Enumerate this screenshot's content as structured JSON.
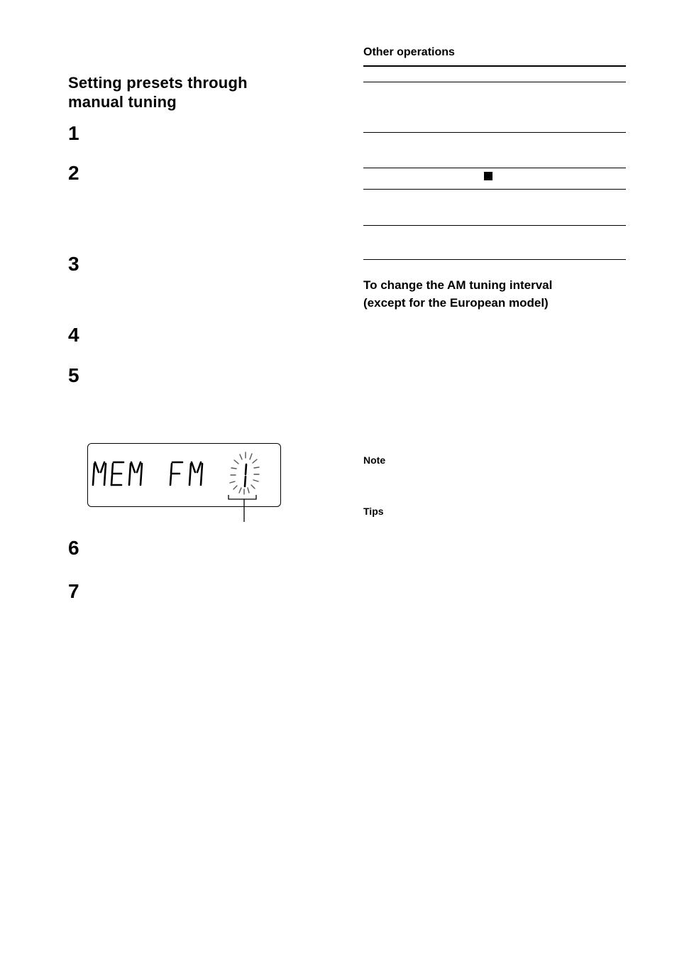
{
  "left_column": {
    "heading": "Setting presets through\nmanual tuning",
    "heading_line1": "Setting presets through",
    "heading_line2": "manual tuning",
    "steps": [
      "1",
      "2",
      "3",
      "4",
      "5",
      "6",
      "7"
    ],
    "display": {
      "text": "MEM FM",
      "preset_number": "1",
      "preset_blinking": true
    }
  },
  "right_column": {
    "other_operations_title": "Other operations",
    "table_icons": [
      "stop-icon"
    ],
    "am_interval_title_line1": "To change the AM tuning interval",
    "am_interval_title_line2": "(except for the European model)",
    "note_label": "Note",
    "tips_label": "Tips"
  }
}
